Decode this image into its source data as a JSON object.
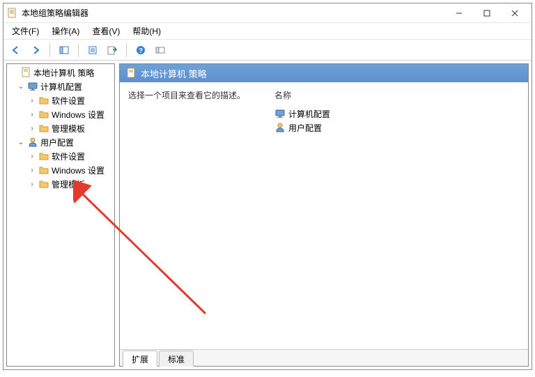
{
  "window": {
    "title": "本地组策略编辑器"
  },
  "menu": {
    "file": "文件(F)",
    "action": "操作(A)",
    "view": "查看(V)",
    "help": "帮助(H)"
  },
  "tree": {
    "root": "本地计算机 策略",
    "computer_cfg": "计算机配置",
    "user_cfg": "用户配置",
    "software": "软件设置",
    "windows": "Windows 设置",
    "admin_templates": "管理模板"
  },
  "detail": {
    "header": "本地计算机 策略",
    "description": "选择一个项目来查看它的描述。",
    "column_name": "名称",
    "items": {
      "computer_cfg": "计算机配置",
      "user_cfg": "用户配置"
    }
  },
  "tabs": {
    "extended": "扩展",
    "standard": "标准"
  }
}
